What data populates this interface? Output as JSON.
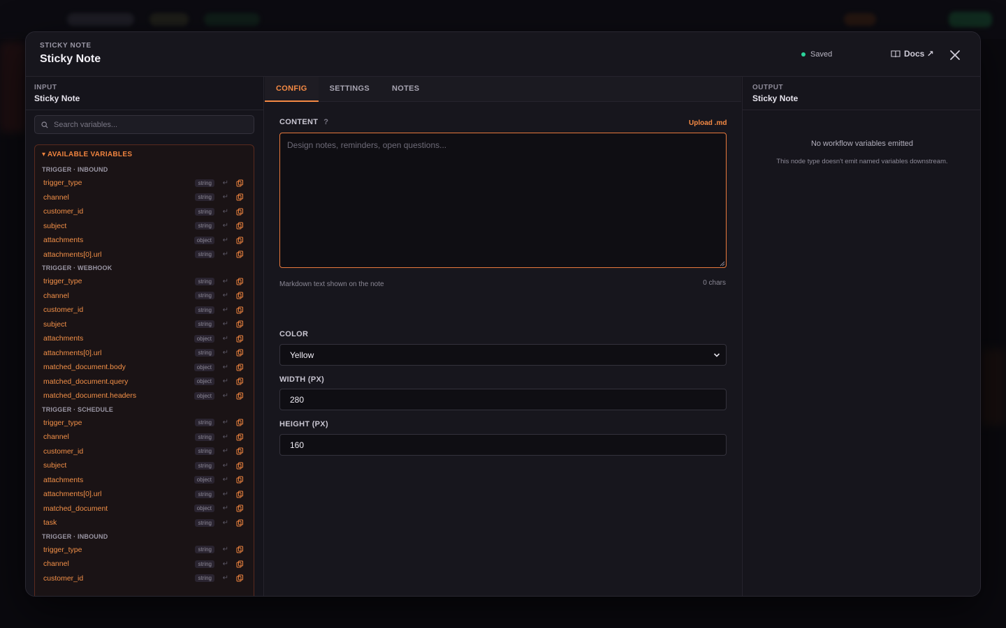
{
  "modal": {
    "eyebrow": "STICKY NOTE",
    "title": "Sticky Note",
    "status": "Saved",
    "docs_label": "Docs ↗"
  },
  "input_panel": {
    "eyebrow": "INPUT",
    "title": "Sticky Note",
    "search_placeholder": "Search variables...",
    "section_label": "▾ AVAILABLE VARIABLES",
    "groups": [
      {
        "label": "TRIGGER · INBOUND",
        "vars": [
          {
            "name": "trigger_type",
            "type": "string"
          },
          {
            "name": "channel",
            "type": "string"
          },
          {
            "name": "customer_id",
            "type": "string"
          },
          {
            "name": "subject",
            "type": "string"
          },
          {
            "name": "attachments",
            "type": "object"
          },
          {
            "name": "attachments[0].url",
            "type": "string"
          }
        ]
      },
      {
        "label": "TRIGGER · WEBHOOK",
        "vars": [
          {
            "name": "trigger_type",
            "type": "string"
          },
          {
            "name": "channel",
            "type": "string"
          },
          {
            "name": "customer_id",
            "type": "string"
          },
          {
            "name": "subject",
            "type": "string"
          },
          {
            "name": "attachments",
            "type": "object"
          },
          {
            "name": "attachments[0].url",
            "type": "string"
          },
          {
            "name": "matched_document.body",
            "type": "object"
          },
          {
            "name": "matched_document.query",
            "type": "object"
          },
          {
            "name": "matched_document.headers",
            "type": "object"
          }
        ]
      },
      {
        "label": "TRIGGER · SCHEDULE",
        "vars": [
          {
            "name": "trigger_type",
            "type": "string"
          },
          {
            "name": "channel",
            "type": "string"
          },
          {
            "name": "customer_id",
            "type": "string"
          },
          {
            "name": "subject",
            "type": "string"
          },
          {
            "name": "attachments",
            "type": "object"
          },
          {
            "name": "attachments[0].url",
            "type": "string"
          },
          {
            "name": "matched_document",
            "type": "object"
          },
          {
            "name": "task",
            "type": "string"
          }
        ]
      },
      {
        "label": "TRIGGER · INBOUND",
        "vars": [
          {
            "name": "trigger_type",
            "type": "string"
          },
          {
            "name": "channel",
            "type": "string"
          },
          {
            "name": "customer_id",
            "type": "string"
          }
        ]
      }
    ]
  },
  "config": {
    "tabs": [
      {
        "label": "CONFIG",
        "active": true
      },
      {
        "label": "SETTINGS",
        "active": false
      },
      {
        "label": "NOTES",
        "active": false
      }
    ],
    "content_label": "CONTENT",
    "help_glyph": "?",
    "upload_label": "Upload .md",
    "content_placeholder": "Design notes, reminders, open questions...",
    "content_hint": "Markdown text shown on the note",
    "char_count": "0 chars",
    "color_label": "COLOR",
    "color_value": "Yellow",
    "width_label": "WIDTH (PX)",
    "width_value": "280",
    "height_label": "HEIGHT (PX)",
    "height_value": "160"
  },
  "output_panel": {
    "eyebrow": "OUTPUT",
    "title": "Sticky Note",
    "empty_title": "No workflow variables emitted",
    "empty_subtitle": "This node type doesn't emit named variables downstream."
  },
  "colors": {
    "accent": "#f58a44",
    "status_saved": "#2bd49a"
  }
}
